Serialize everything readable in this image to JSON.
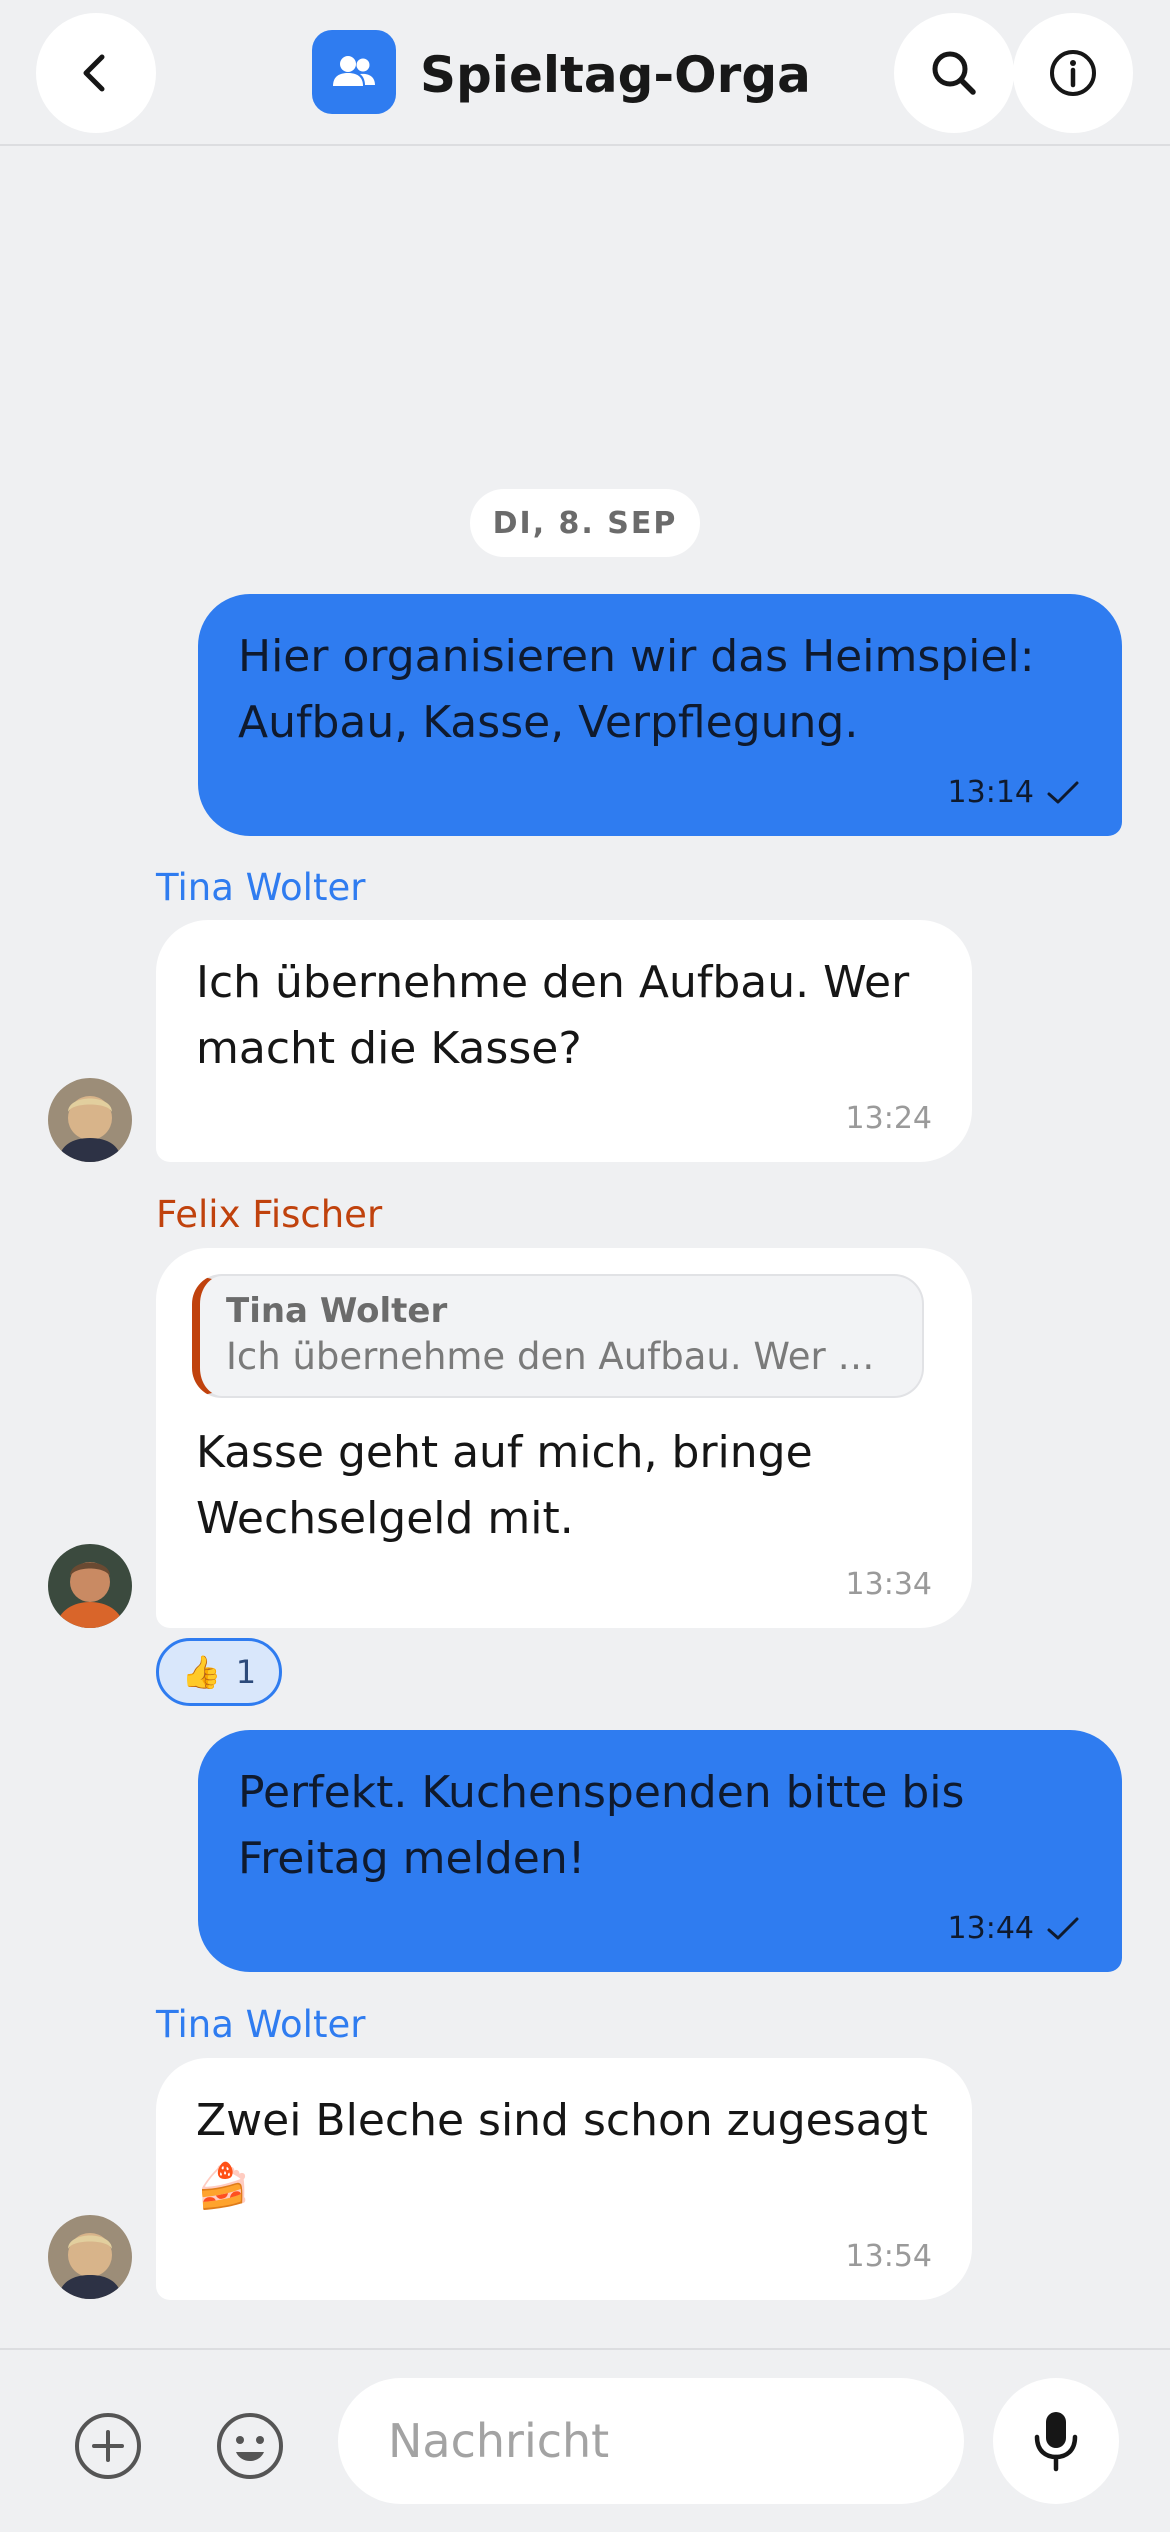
{
  "header": {
    "title": "Spieltag-Orga",
    "back_icon": "chevron-left-icon",
    "group_icon": "people-icon",
    "search_icon": "search-icon",
    "info_icon": "info-icon",
    "accent": "#2f7cf0"
  },
  "date_divider": "DI, 8. SEP",
  "messages": [
    {
      "direction": "outgoing",
      "text": "Hier organisieren wir das Heimspiel:\nAufbau, Kasse, Verpflegung.",
      "time": "13:14",
      "status": "sent-check"
    },
    {
      "direction": "incoming",
      "sender": "Tina Wolter",
      "text": "Ich übernehme den Aufbau. Wer\nmacht die Kasse?",
      "time": "13:24"
    },
    {
      "direction": "incoming",
      "sender": "Felix Fischer",
      "quote": {
        "name": "Tina Wolter",
        "text": "Ich übernehme den Aufbau. Wer mac..."
      },
      "text": "Kasse geht auf mich, bringe\nWechselgeld mit.",
      "time": "13:34",
      "reaction": {
        "emoji": "👍",
        "count": "1"
      }
    },
    {
      "direction": "outgoing",
      "text": "Perfekt. Kuchenspenden bitte bis\nFreitag melden!",
      "time": "13:44",
      "status": "sent-check"
    },
    {
      "direction": "incoming",
      "sender": "Tina Wolter",
      "text": "Zwei Bleche sind schon zugesagt\n🍰",
      "time": "13:54"
    }
  ],
  "composer": {
    "placeholder": "Nachricht",
    "value": "",
    "attach_icon": "plus-circle-icon",
    "emoji_icon": "smiley-icon",
    "mic_icon": "microphone-icon"
  }
}
